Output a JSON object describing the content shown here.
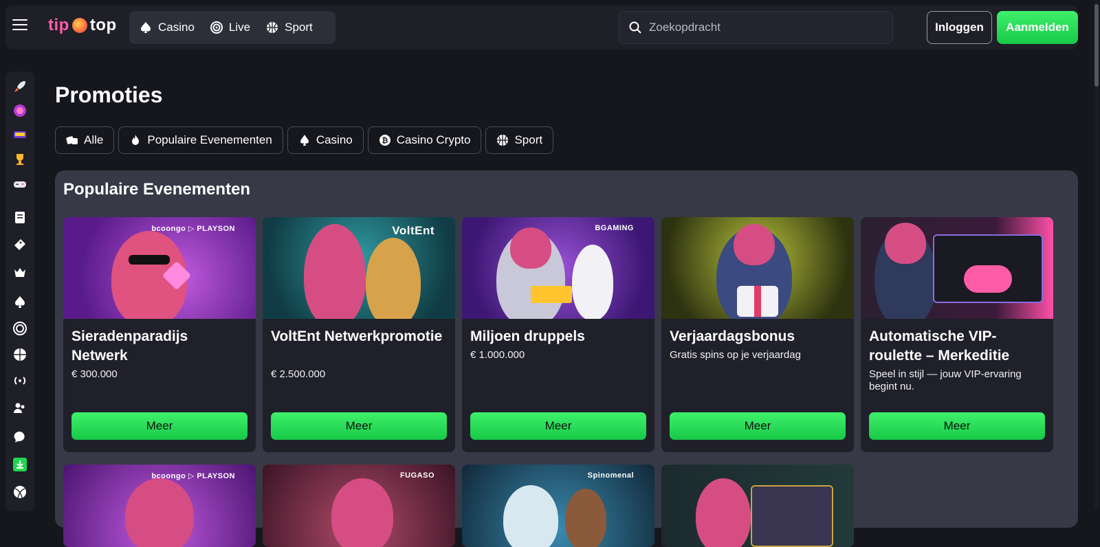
{
  "header": {
    "logo": {
      "part1": "tip",
      "part2": "top"
    },
    "nav": [
      {
        "label": "Casino",
        "icon": "spade-icon"
      },
      {
        "label": "Live",
        "icon": "target-icon"
      },
      {
        "label": "Sport",
        "icon": "basketball-icon"
      }
    ],
    "search_placeholder": "Zoekopdracht",
    "login_label": "Inloggen",
    "register_label": "Aanmelden"
  },
  "sidebar": {
    "icons": [
      "rocket-icon",
      "token-icon",
      "store-icon",
      "trophy-icon",
      "gamepad-icon",
      "clipboard-icon",
      "ticket-icon",
      "crown-icon",
      "spade-icon",
      "target-icon",
      "basketball-icon",
      "broadcast-icon",
      "users-icon",
      "chat-icon",
      "download-icon",
      "sport-ball-icon"
    ]
  },
  "page": {
    "title": "Promoties",
    "filters": [
      {
        "label": "Alle",
        "icon": "dice-icon"
      },
      {
        "label": "Populaire Evenementen",
        "icon": "fire-icon"
      },
      {
        "label": "Casino",
        "icon": "spade-icon"
      },
      {
        "label": "Casino Crypto",
        "icon": "bitcoin-icon"
      },
      {
        "label": "Sport",
        "icon": "basketball-icon"
      }
    ]
  },
  "section": {
    "title": "Populaire Evenementen",
    "cards": [
      {
        "title": "Sieradenparadijs Netwerk",
        "subtitle": "€ 300.000",
        "button": "Meer",
        "provider": "bcoongo ▷ PLAYSON",
        "theme": "#8a2cc0"
      },
      {
        "title": "VoltEnt Netwerkpromotie",
        "subtitle": "€ 2.500.000",
        "button": "Meer",
        "provider": "VoltEnt",
        "theme": "#1f6d72"
      },
      {
        "title": "Miljoen druppels",
        "subtitle": "€ 1.000.000",
        "button": "Meer",
        "provider": "BGAMING",
        "theme": "#6a2fb5"
      },
      {
        "title": "Verjaardagsbonus",
        "subtitle": "Gratis spins op je verjaardag",
        "button": "Meer",
        "provider": "",
        "theme": "#6f7a1e"
      },
      {
        "title": "Automatische VIP-roulette – Merkeditie",
        "subtitle": "Speel in stijl — jouw VIP-ervaring begint nu.",
        "button": "Meer",
        "provider": "",
        "theme": "#2a1e2e"
      }
    ],
    "second_row_providers": [
      "bcoongo ▷ PLAYSON",
      "FUGASO",
      "Spinomenal",
      ""
    ]
  },
  "colors": {
    "accent_green": "#22d651",
    "brand_pink": "#ff5ca8",
    "panel": "#373947",
    "bg": "#16171d"
  }
}
